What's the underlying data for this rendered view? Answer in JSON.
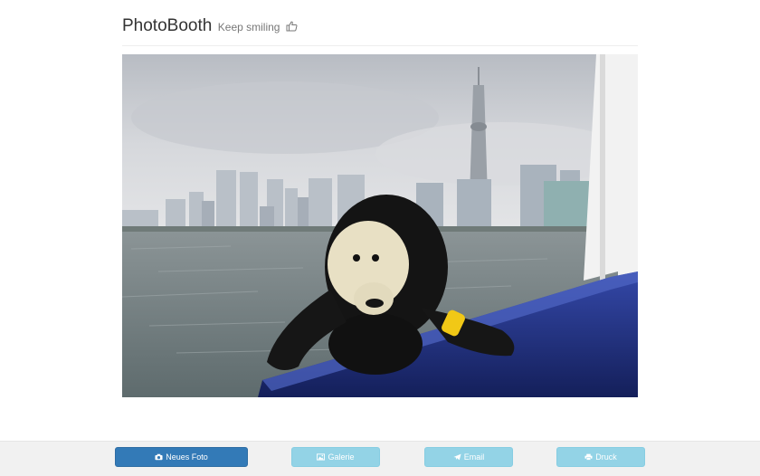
{
  "header": {
    "title": "PhotoBooth",
    "subtitle": "Keep smiling",
    "subtitle_icon": "thumbs-up-icon"
  },
  "photo": {
    "subject": "stuffed-monkey-toy-on-boat-railing",
    "background": "city-skyline-with-tower-over-water"
  },
  "toolbar": {
    "new_photo_label": "Neues Foto",
    "new_photo_icon": "camera-icon",
    "gallery_label": "Galerie",
    "gallery_icon": "picture-icon",
    "email_label": "Email",
    "email_icon": "paper-plane-icon",
    "print_label": "Druck",
    "print_icon": "printer-icon"
  },
  "colors": {
    "primary_button": "#337ab7",
    "secondary_button": "#93d3e6",
    "footer_background": "#f1f1f1"
  }
}
